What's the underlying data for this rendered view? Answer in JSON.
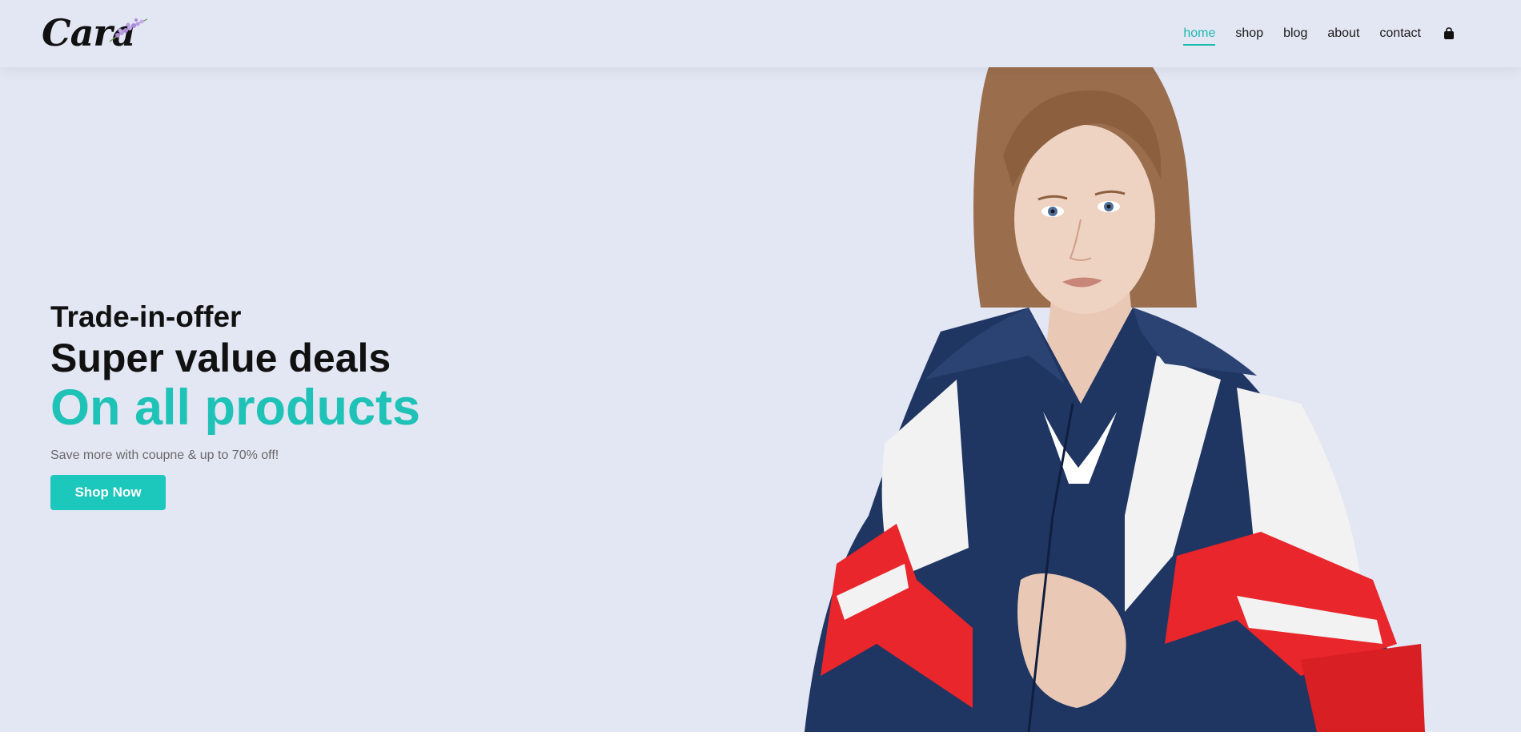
{
  "brand": {
    "logo_text": "Cara"
  },
  "nav": {
    "items": [
      {
        "label": "home",
        "active": true
      },
      {
        "label": "shop",
        "active": false
      },
      {
        "label": "blog",
        "active": false
      },
      {
        "label": "about",
        "active": false
      },
      {
        "label": "contact",
        "active": false
      }
    ],
    "cart_icon": "shopping-bag-icon"
  },
  "hero": {
    "eyebrow": "Trade-in-offer",
    "headline": "Super value deals",
    "highlight": "On all products",
    "subtext": "Save more with coupne & up to 70% off!",
    "cta_label": "Shop Now",
    "image_subject": "model-photo"
  },
  "colors": {
    "accent": "#1fc2b6",
    "button": "#1cc7bc",
    "hero_bg": "#e3e6f3",
    "jacket_navy": "#1f3562",
    "jacket_red": "#e8262b"
  }
}
